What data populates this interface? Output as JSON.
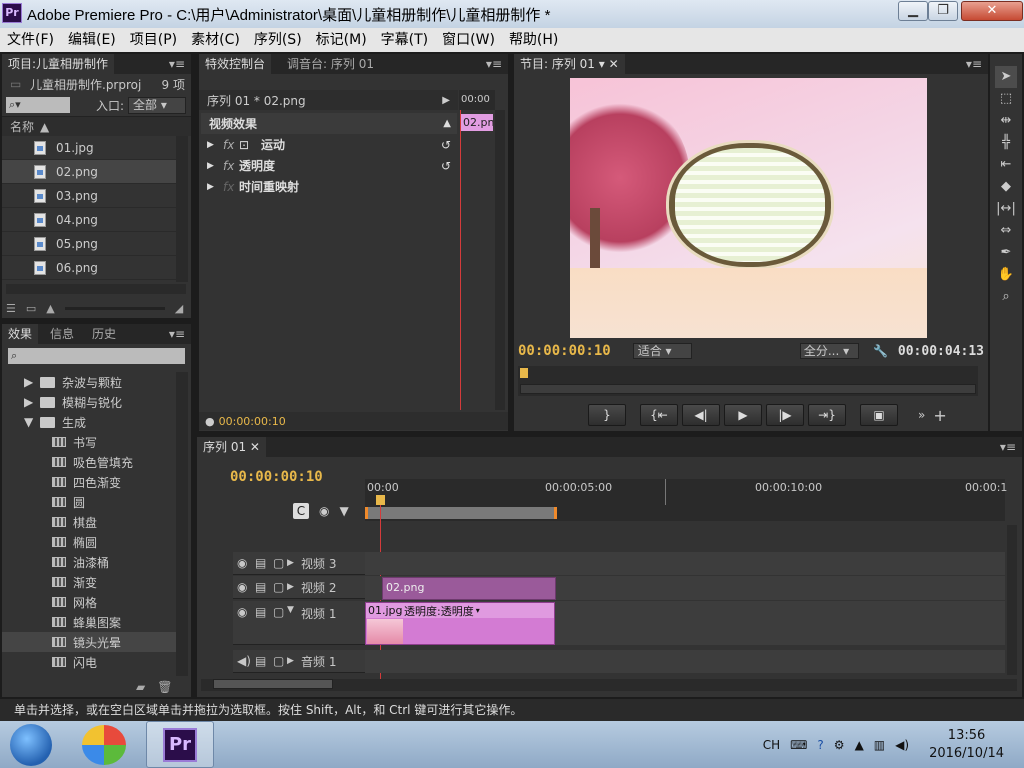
{
  "window": {
    "title": "Adobe Premiere Pro - C:\\用户\\Administrator\\桌面\\儿童相册制作\\儿童相册制作 *",
    "app_icon": "Pr"
  },
  "menu": [
    "文件(F)",
    "编辑(E)",
    "项目(P)",
    "素材(C)",
    "序列(S)",
    "标记(M)",
    "字幕(T)",
    "窗口(W)",
    "帮助(H)"
  ],
  "project": {
    "tab": "项目:儿童相册制作",
    "file": "儿童相册制作.prproj",
    "count": "9 项",
    "entry_label": "入口:",
    "entry_value": "全部",
    "column_name": "名称",
    "items": [
      "01.jpg",
      "02.png",
      "03.png",
      "04.png",
      "05.png",
      "06.png"
    ]
  },
  "effects": {
    "tabs": [
      "效果",
      "信息",
      "历史"
    ],
    "folders": [
      "杂波与颗粒",
      "模糊与锐化",
      "生成"
    ],
    "items": [
      "书写",
      "吸色管填充",
      "四色渐变",
      "圆",
      "棋盘",
      "椭圆",
      "油漆桶",
      "渐变",
      "网格",
      "蜂巢图案",
      "镜头光晕",
      "闪电"
    ]
  },
  "fx_controls": {
    "tabs": [
      "特效控制台",
      "调音台: 序列 01"
    ],
    "header": "序列 01 * 02.png",
    "ruler": "00:00",
    "clip": "02.pn",
    "section": "视频效果",
    "rows": [
      "运动",
      "透明度",
      "时间重映射"
    ],
    "timecode": "00:00:00:10"
  },
  "program": {
    "tab": "节目: 序列 01",
    "timecode": "00:00:00:10",
    "fit": "适合",
    "quality": "全分...",
    "duration": "00:00:04:13"
  },
  "timeline": {
    "tab": "序列 01",
    "timecode": "00:00:00:10",
    "ruler": [
      "00:00",
      "00:00:05:00",
      "00:00:10:00",
      "00:00:1"
    ],
    "tracks": [
      "视频 3",
      "视频 2",
      "视频 1",
      "音频 1"
    ],
    "clip_v2": "02.png",
    "clip_v1": "01.jpg",
    "clip_v1_fx": "透明度:透明度"
  },
  "status": "单击并选择，或在空白区域单击并拖拉为选取框。按住 Shift，Alt，和 Ctrl 键可进行其它操作。",
  "taskbar": {
    "lang": "CH",
    "time": "13:56",
    "date": "2016/10/14"
  }
}
